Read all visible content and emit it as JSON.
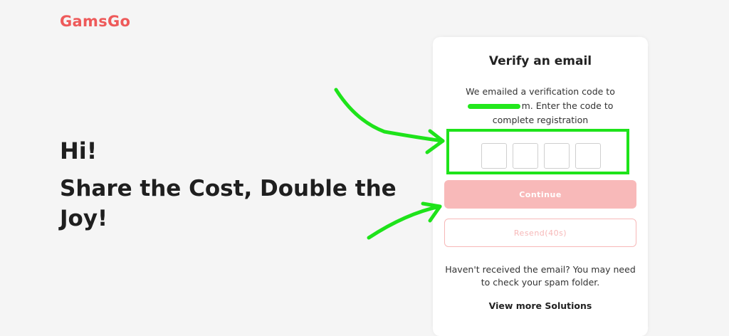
{
  "brand": {
    "logo_text": "GamsGo",
    "color": "#ee5a5a"
  },
  "hero": {
    "greeting": "Hi!",
    "tagline": "Share the Cost, Double the Joy!"
  },
  "verify_card": {
    "title": "Verify an email",
    "description_before": "We emailed a verification code to",
    "description_after": "m. Enter the code to complete registration",
    "code_cells": [
      "",
      "",
      "",
      ""
    ],
    "continue_label": "Continue",
    "resend_label": "Resend(40s)",
    "help_text": "Haven't received the email? You may need to check your spam folder.",
    "solutions_link": "View more Solutions"
  },
  "colors": {
    "primary_disabled": "#f8b9b9",
    "annotation_green": "#1ee31a"
  }
}
